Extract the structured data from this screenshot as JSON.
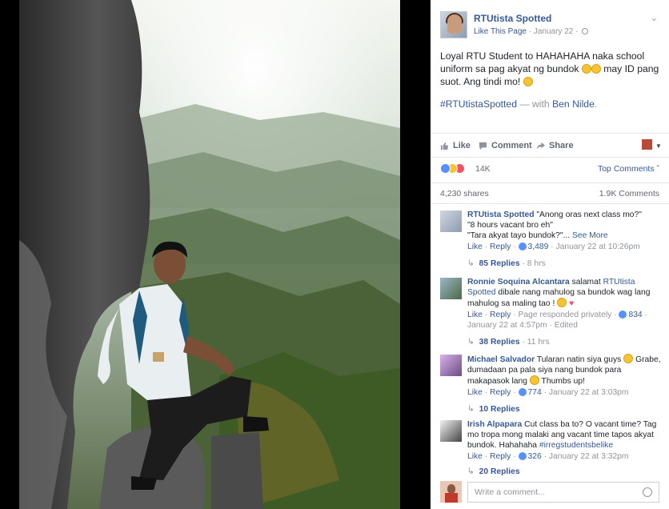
{
  "post": {
    "page_name": "RTUtista Spotted",
    "like_page": "Like This Page",
    "date": "January 22",
    "text": "Loyal RTU Student to HAHAHAHA naka school uniform sa pag akyat ng bundok",
    "text_2": "may ID pang suot. Ang tindi mo!",
    "hashtag": "#RTUtistaSpotted",
    "with_prefix": "— with",
    "tagged": "Ben Nilde",
    "tagged_suffix": "."
  },
  "actions": {
    "like": "Like",
    "comment": "Comment",
    "share": "Share"
  },
  "reactions": {
    "count": "14K",
    "top_comments": "Top Comments ˇ"
  },
  "stats": {
    "shares": "4,230 shares",
    "comments": "1.9K Comments"
  },
  "comments": [
    {
      "name": "RTUtista Spotted",
      "text": "\"Anong oras next class mo?\"",
      "text_line2": "\"8 hours vacant bro eh\"",
      "text_line3": "\"Tara akyat tayo bundok?\"...",
      "see_more": "See More",
      "like": "Like",
      "reply": "Reply",
      "likes": "3,489",
      "time": "January 22 at 10:26pm",
      "replies": "85 Replies",
      "replies_time": "8 hrs"
    },
    {
      "name": "Ronnie Soquina Alcantara",
      "text": "salamat",
      "mention": "RTUtista Spotted",
      "text_rest": "dibale nang mahulog sa bundok wag lang mahulog sa maling tao !",
      "like": "Like",
      "reply": "Reply",
      "responded": "Page responded privately",
      "likes": "834",
      "time": "January 22 at 4:57pm",
      "edited": "Edited",
      "replies": "38 Replies",
      "replies_time": "11 hrs"
    },
    {
      "name": "Michael Salvador",
      "text": "Tularan natin siya guys",
      "text_rest": "Grabe, dumadaan pa pala siya nang bundok para makapasok lang",
      "text_end": "Thumbs up!",
      "like": "Like",
      "reply": "Reply",
      "likes": "774",
      "time": "January 22 at 3:03pm",
      "replies": "10 Replies"
    },
    {
      "name": "Irish Alpapara",
      "text": "Cut class ba to? O vacant time? Tag mo tropa mong malaki ang vacant time tapos akyat bundok. Hahahaha",
      "hashtag": "#irregstudentsbelike",
      "like": "Like",
      "reply": "Reply",
      "likes": "326",
      "time": "January 22 at 3:32pm",
      "replies": "20 Replies"
    }
  ],
  "comment_box": {
    "placeholder": "Write a comment..."
  },
  "colors": {
    "link": "#365899",
    "meta": "#90949c",
    "text": "#1d2129"
  },
  "icons": [
    "globe-icon",
    "chevron-down-icon",
    "like-icon",
    "comment-icon",
    "share-icon",
    "emoji-icon"
  ]
}
